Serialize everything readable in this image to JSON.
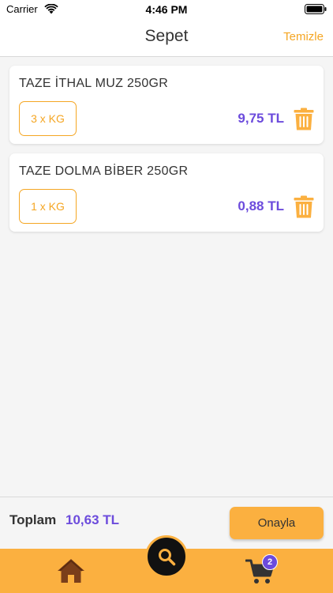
{
  "status_bar": {
    "carrier": "Carrier",
    "time": "4:46 PM"
  },
  "nav": {
    "title": "Sepet",
    "clear_label": "Temizle"
  },
  "cart": {
    "items": [
      {
        "name": "TAZE İTHAL MUZ 250GR",
        "quantity": "3 x KG",
        "price": "9,75 TL"
      },
      {
        "name": "TAZE DOLMA BİBER 250GR",
        "quantity": "1 x KG",
        "price": "0,88 TL"
      }
    ]
  },
  "summary": {
    "total_label": "Toplam",
    "total_value": "10,63 TL",
    "confirm_label": "Onayla"
  },
  "tab_bar": {
    "items": [
      {
        "icon": "home-icon"
      },
      {
        "icon": "search-icon"
      },
      {
        "icon": "cart-icon"
      }
    ],
    "cart_count": "2"
  },
  "colors": {
    "accent": "#fbb040",
    "accent_text": "#f5a623",
    "price": "#6c4bdc",
    "background": "#f5f5f5"
  }
}
